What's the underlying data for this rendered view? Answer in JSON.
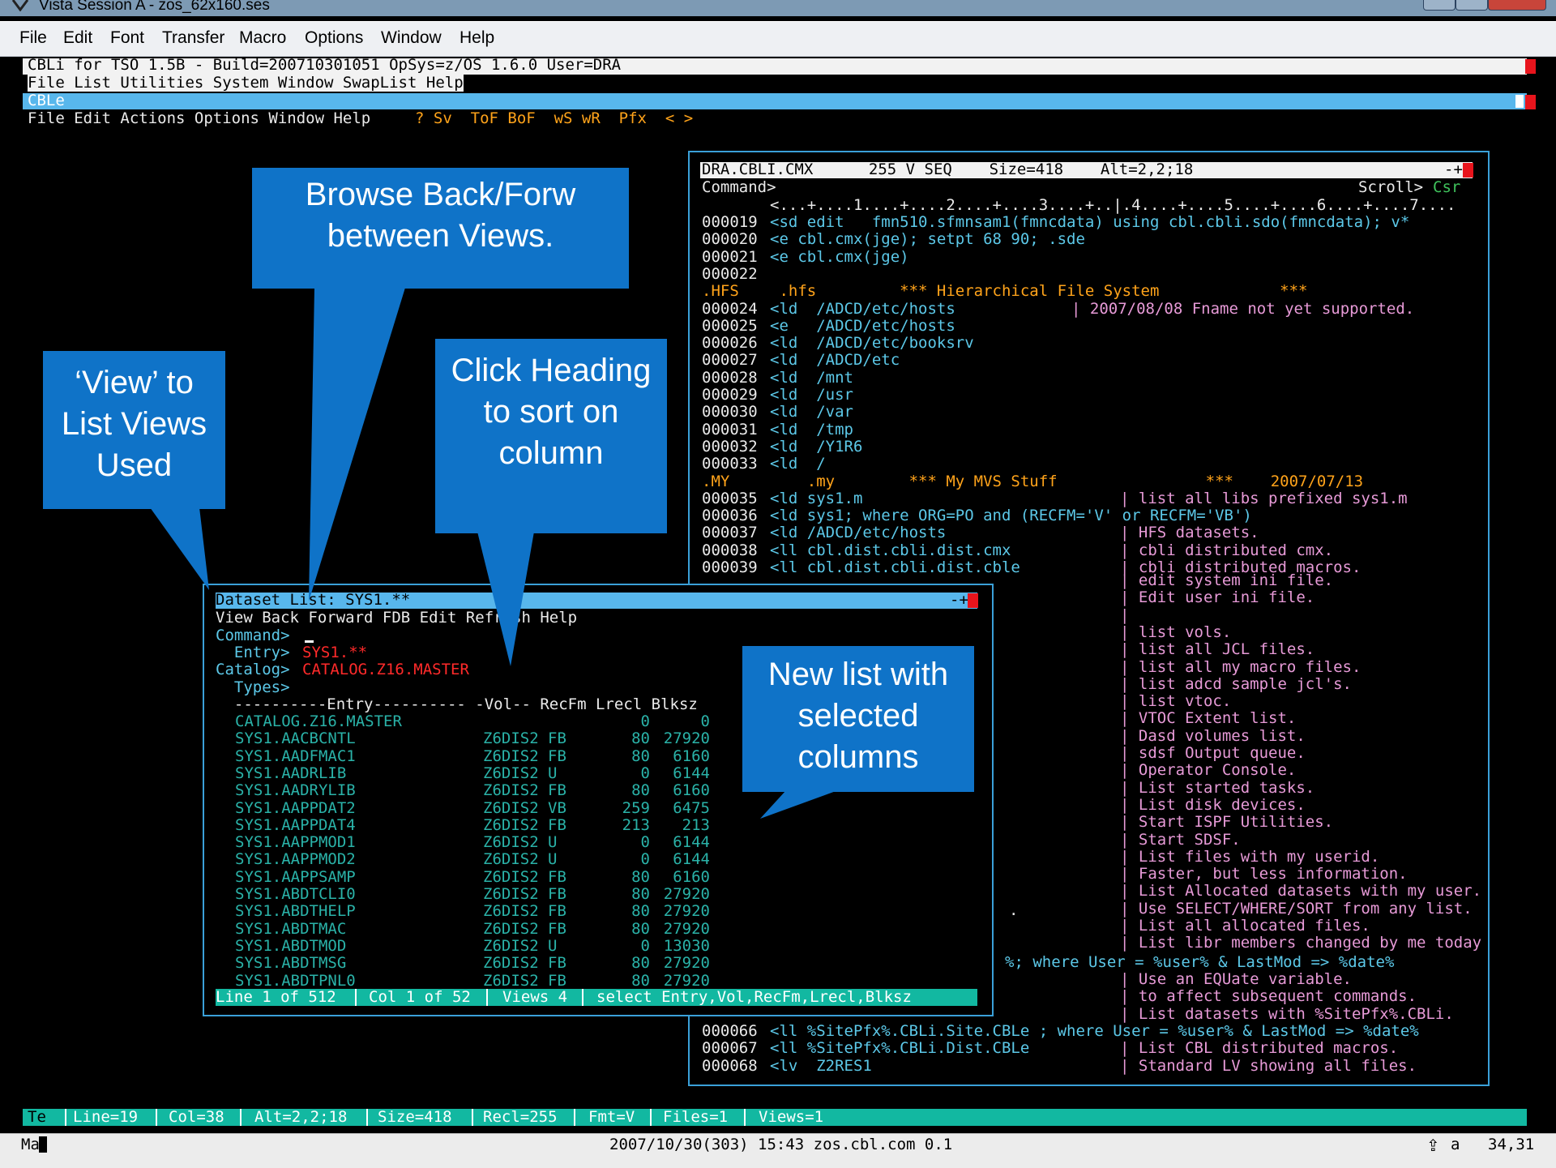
{
  "window": {
    "title": "Vista Session A - zos_62x160.ses"
  },
  "menu": [
    "File",
    "Edit",
    "Font",
    "Transfer",
    "Macro",
    "Options",
    "Window",
    "Help"
  ],
  "term": {
    "header": "CBLi for TSO 1.5B - Build=200710301051 OpSys=z/OS 1.6.0 User=DRA",
    "top_menu": "File List Utilities System Window SwapList Help",
    "cble_title": "CBLe",
    "cble_menu": "File Edit Actions Options Window Help",
    "cble_tools": "? Sv  ToF BoF  wS wR  Pfx  < >"
  },
  "editor": {
    "title": "DRA.CBLI.CMX      255 V SEQ    Size=418    Alt=2,2;18",
    "controls": "-+",
    "command_label": "Command>",
    "scroll_label": "Scroll>",
    "scroll_value": "Csr",
    "ruler": "<...+....1....+....2....+....3....+..|.4....+....5....+....6....+....7....",
    "lines": [
      {
        "n": "000019",
        "cmd": "<sd edit   fmn510.sfmnsam1(fmncdata) using cbl.cbli.sdo(fmncdata); v*",
        "note": ""
      },
      {
        "n": "000020",
        "cmd": "<e cbl.cmx(jge); setpt 68 90; .sde",
        "note": ""
      },
      {
        "n": "000021",
        "cmd": "<e cbl.cmx(jge)",
        "note": ""
      },
      {
        "n": "000022",
        "cmd": "",
        "note": ""
      },
      {
        "n": ".HFS",
        "cmd": " .hfs         *** Hierarchical File System             ***",
        "note": "",
        "hdr": true
      },
      {
        "n": "000024",
        "cmd": "<ld  /ADCD/etc/hosts",
        "note": "| 2007/08/08 Fname not yet supported.",
        "orange": true
      },
      {
        "n": "000025",
        "cmd": "<e   /ADCD/etc/hosts",
        "note": ""
      },
      {
        "n": "000026",
        "cmd": "<ld  /ADCD/etc/booksrv",
        "note": ""
      },
      {
        "n": "000027",
        "cmd": "<ld  /ADCD/etc",
        "note": ""
      },
      {
        "n": "000028",
        "cmd": "<ld  /mnt",
        "note": ""
      },
      {
        "n": "000029",
        "cmd": "<ld  /usr",
        "note": ""
      },
      {
        "n": "000030",
        "cmd": "<ld  /var",
        "note": ""
      },
      {
        "n": "000031",
        "cmd": "<ld  /tmp",
        "note": ""
      },
      {
        "n": "000032",
        "cmd": "<ld  /Y1R6",
        "note": ""
      },
      {
        "n": "000033",
        "cmd": "<ld  /",
        "note": ""
      },
      {
        "n": ".MY",
        "cmd": "    .my        *** My MVS Stuff                ***    2007/07/13",
        "note": "",
        "hdr": true
      },
      {
        "n": "000035",
        "cmd": "<ld sys1.m",
        "note": "| list all libs prefixed sys1.m"
      },
      {
        "n": "000036",
        "cmd": "<ld sys1; where ORG=PO and (RECFM='V' or RECFM='VB')",
        "note": ""
      },
      {
        "n": "000037",
        "cmd": "<ld /ADCD/etc/hosts",
        "note": "| HFS datasets."
      },
      {
        "n": "000038",
        "cmd": "<ll cbl.dist.cbli.dist.cmx",
        "note": "| cbli distributed cmx."
      },
      {
        "n": "000039",
        "cmd": "<ll cbl.dist.cbli.dist.cble",
        "note": "| cbli distributed macros."
      }
    ],
    "notes_right": [
      "| edit system ini file.",
      "| Edit user ini file.",
      "|",
      "| list vols.",
      "| list all JCL files.",
      "| list all my macro files.",
      "| list adcd sample jcl's.",
      "| list vtoc.",
      "| VTOC Extent list.",
      "| Dasd volumes list.",
      "| sdsf Output queue.",
      "| Operator Console.",
      "| List started tasks.",
      "| List disk devices.",
      "| Start ISPF Utilities.",
      "| Start SDSF.",
      "| List files with my userid.",
      "| Faster, but less information.",
      "| List Allocated datasets with my user.",
      "| Use SELECT/WHERE/SORT from any list.",
      "| List all allocated files.",
      "| List libr members changed by me today"
    ],
    "where_line": "%; where User = %user% & LastMod => %date%",
    "notes_right2": [
      "| Use an EQUate variable.",
      "| to affect subsequent commands.",
      "| List datasets with %SitePfx%.CBLi."
    ],
    "tail_lines": [
      {
        "n": "000066",
        "cmd": "<ll %SitePfx%.CBLi.Site.CBLe ; where User = %user% & LastMod => %date%",
        "note": ""
      },
      {
        "n": "000067",
        "cmd": "<ll %SitePfx%.CBLi.Dist.CBLe",
        "note": "| List CBL distributed macros."
      },
      {
        "n": "000068",
        "cmd": "<lv  Z2RES1",
        "note": "| Standard LV showing all files."
      }
    ]
  },
  "dslist": {
    "title": "Dataset List: SYS1.**",
    "controls": "-+",
    "menu": "View Back Forward FDB Edit Refresh Help",
    "command_label": "Command>",
    "entry_label": "  Entry>",
    "entry_value": "SYS1.**",
    "catalog_label": "Catalog>",
    "catalog_value": "CATALOG.Z16.MASTER",
    "types_label": "  Types>",
    "header": "  ----------Entry---------- -Vol-- RecFm Lrecl Blksz",
    "rows": [
      {
        "entry": "CATALOG.Z16.MASTER",
        "vol": "",
        "recfm": "",
        "lrecl": "0",
        "blksz": "0"
      },
      {
        "entry": "SYS1.AACBCNTL",
        "vol": "Z6DIS2",
        "recfm": "FB",
        "lrecl": "80",
        "blksz": "27920"
      },
      {
        "entry": "SYS1.AADFMAC1",
        "vol": "Z6DIS2",
        "recfm": "FB",
        "lrecl": "80",
        "blksz": "6160"
      },
      {
        "entry": "SYS1.AADRLIB",
        "vol": "Z6DIS2",
        "recfm": "U",
        "lrecl": "0",
        "blksz": "6144"
      },
      {
        "entry": "SYS1.AADRYLIB",
        "vol": "Z6DIS2",
        "recfm": "FB",
        "lrecl": "80",
        "blksz": "6160"
      },
      {
        "entry": "SYS1.AAPPDAT2",
        "vol": "Z6DIS2",
        "recfm": "VB",
        "lrecl": "259",
        "blksz": "6475"
      },
      {
        "entry": "SYS1.AAPPDAT4",
        "vol": "Z6DIS2",
        "recfm": "FB",
        "lrecl": "213",
        "blksz": "213"
      },
      {
        "entry": "SYS1.AAPPMOD1",
        "vol": "Z6DIS2",
        "recfm": "U",
        "lrecl": "0",
        "blksz": "6144"
      },
      {
        "entry": "SYS1.AAPPMOD2",
        "vol": "Z6DIS2",
        "recfm": "U",
        "lrecl": "0",
        "blksz": "6144"
      },
      {
        "entry": "SYS1.AAPPSAMP",
        "vol": "Z6DIS2",
        "recfm": "FB",
        "lrecl": "80",
        "blksz": "6160"
      },
      {
        "entry": "SYS1.ABDTCLI0",
        "vol": "Z6DIS2",
        "recfm": "FB",
        "lrecl": "80",
        "blksz": "27920"
      },
      {
        "entry": "SYS1.ABDTHELP",
        "vol": "Z6DIS2",
        "recfm": "FB",
        "lrecl": "80",
        "blksz": "27920"
      },
      {
        "entry": "SYS1.ABDTMAC",
        "vol": "Z6DIS2",
        "recfm": "FB",
        "lrecl": "80",
        "blksz": "27920"
      },
      {
        "entry": "SYS1.ABDTMOD",
        "vol": "Z6DIS2",
        "recfm": "U",
        "lrecl": "0",
        "blksz": "13030"
      },
      {
        "entry": "SYS1.ABDTMSG",
        "vol": "Z6DIS2",
        "recfm": "FB",
        "lrecl": "80",
        "blksz": "27920"
      },
      {
        "entry": "SYS1.ABDTPNL0",
        "vol": "Z6DIS2",
        "recfm": "FB",
        "lrecl": "80",
        "blksz": "27920"
      }
    ],
    "status": {
      "line": "Line 1 of 512",
      "col": "Col 1 of 52",
      "views": "Views 4",
      "select": "select Entry,Vol,RecFm,Lrecl,Blksz"
    }
  },
  "callouts": {
    "browse": "Browse Back/Forw between Views.",
    "view": "‘View’ to List Views Used",
    "click": "Click Heading to sort on column",
    "newlist": "New list with selected columns"
  },
  "statusbar": {
    "mode": "Te",
    "line": "Line=19",
    "col": "Col=38",
    "alt": "Alt=2,2;18",
    "size": "Size=418",
    "recl": "Recl=255",
    "fmt": "Fmt=V",
    "files": "Files=1",
    "views": "Views=1"
  },
  "bottom": {
    "left": "Ma",
    "center": "2007/10/30(303) 15:43 zos.cbl.com 0.1",
    "right_a": "a",
    "right_pos": "34,31"
  },
  "colors": {
    "accent": "#58b7ec",
    "callout": "#0f73c8",
    "status": "#12b8a1"
  }
}
